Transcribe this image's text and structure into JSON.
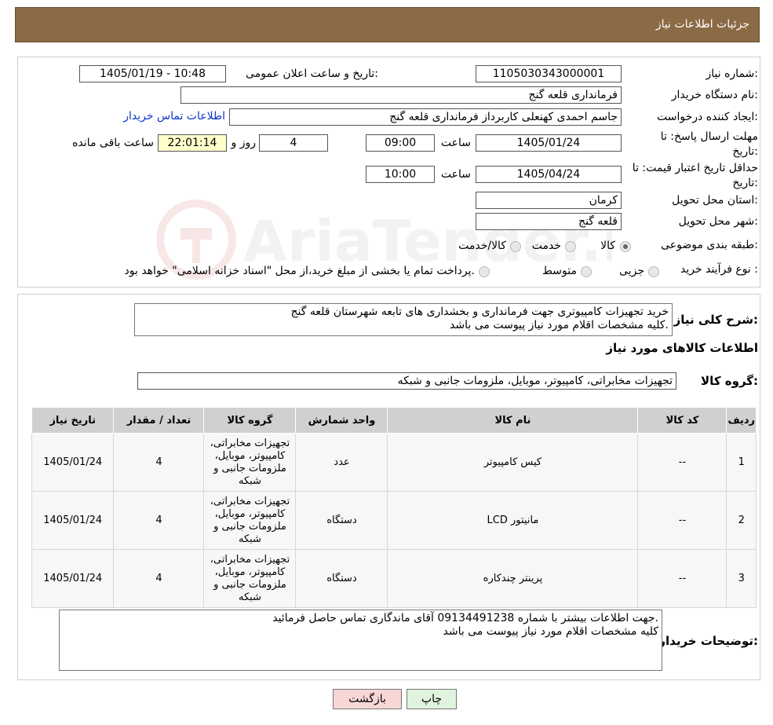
{
  "header": {
    "title": "جزئیات اطلاعات نیاز"
  },
  "form": {
    "need_number_label": "شماره نیاز:",
    "need_number": "1105030343000001",
    "announce_label": "تاریخ و ساعت اعلان عمومی:",
    "announce_value": "1405/01/19 - 10:48",
    "buyer_org_label": "نام دستگاه خریدار:",
    "buyer_org": "فرمانداری قلعه گنج",
    "creator_label": "ایجاد کننده درخواست:",
    "creator": "جاسم احمدی کهنعلی کاربرداز فرمانداری قلعه گنج",
    "contact_link": "اطلاعات تماس خریدار",
    "deadline_label": "مهلت ارسال پاسخ: تا تاریخ:",
    "deadline_date": "1405/01/24",
    "hour_label": "ساعت",
    "deadline_time": "09:00",
    "days_value": "4",
    "days_label": "روز و",
    "remaining_time": "22:01:14",
    "remaining_label": "ساعت باقی مانده",
    "validity_label": "حداقل تاریخ اعتبار قیمت: تا تاریخ:",
    "validity_date": "1405/04/24",
    "validity_time": "10:00",
    "province_label": "استان محل تحویل:",
    "province": "کرمان",
    "city_label": "شهر محل تحویل:",
    "city": "قلعه گنج",
    "category_label": "طبقه بندی موضوعی:",
    "category_options": [
      "کالا",
      "خدمت",
      "کالا/خدمت"
    ],
    "process_label": "نوع فرآیند خرید :",
    "process_options": [
      "جزیی",
      "متوسط"
    ],
    "process_note": "پرداخت تمام یا بخشی از مبلغ خرید،از محل \"اسناد خزانه اسلامی\" خواهد بود."
  },
  "summary": {
    "label": "شرح کلی نیاز:",
    "line1": "خرید تجهیزات کامپیوتری جهت فرمانداری و بخشداری های تابعه شهرستان قلعه گنج",
    "line2": "کلیه مشخصات اقلام مورد نیاز پیوست می باشد."
  },
  "goods_title": "اطلاعات کالاهای مورد نیاز",
  "goods_group_label": "گروه کالا:",
  "goods_group": "تجهیزات مخابراتی، کامپیوتر، موبایل، ملزومات جانبی و شبکه",
  "table": {
    "headers": [
      "ردیف",
      "کد کالا",
      "نام کالا",
      "واحد شمارش",
      "گروه کالا",
      "تعداد / مقدار",
      "تاریخ نیاز"
    ],
    "rows": [
      {
        "num": "1",
        "code": "--",
        "name": "کیس کامپیوتر",
        "unit": "عدد",
        "group": "تجهیزات مخابراتی، کامپیوتر، موبایل، ملزومات جانبی و شبکه",
        "qty": "4",
        "date": "1405/01/24"
      },
      {
        "num": "2",
        "code": "--",
        "name": "مانیتور LCD",
        "unit": "دستگاه",
        "group": "تجهیزات مخابراتی، کامپیوتر، موبایل، ملزومات جانبی و شبکه",
        "qty": "4",
        "date": "1405/01/24"
      },
      {
        "num": "3",
        "code": "--",
        "name": "پرینتر چندکاره",
        "unit": "دستگاه",
        "group": "تجهیزات مخابراتی، کامپیوتر، موبایل، ملزومات جانبی و شبکه",
        "qty": "4",
        "date": "1405/01/24"
      }
    ]
  },
  "buyer_notes": {
    "label": "توضیحات خریدار:",
    "line1": "جهت اطلاعات بیشتر با شماره 09134491238 آقای ماندگاری تماس حاصل فرمائید.",
    "line2": "کلیه مشخصات اقلام مورد نیاز پیوست می باشد"
  },
  "buttons": {
    "print": "چاپ",
    "back": "بازگشت"
  },
  "watermark": "AriaTender.neT",
  "colors": {
    "header_bg": "#8b6a46",
    "timer_bg": "#ffffcc",
    "link": "#0a35c8",
    "back_bg": "#f9d6d6",
    "print_bg": "#dff3df"
  }
}
